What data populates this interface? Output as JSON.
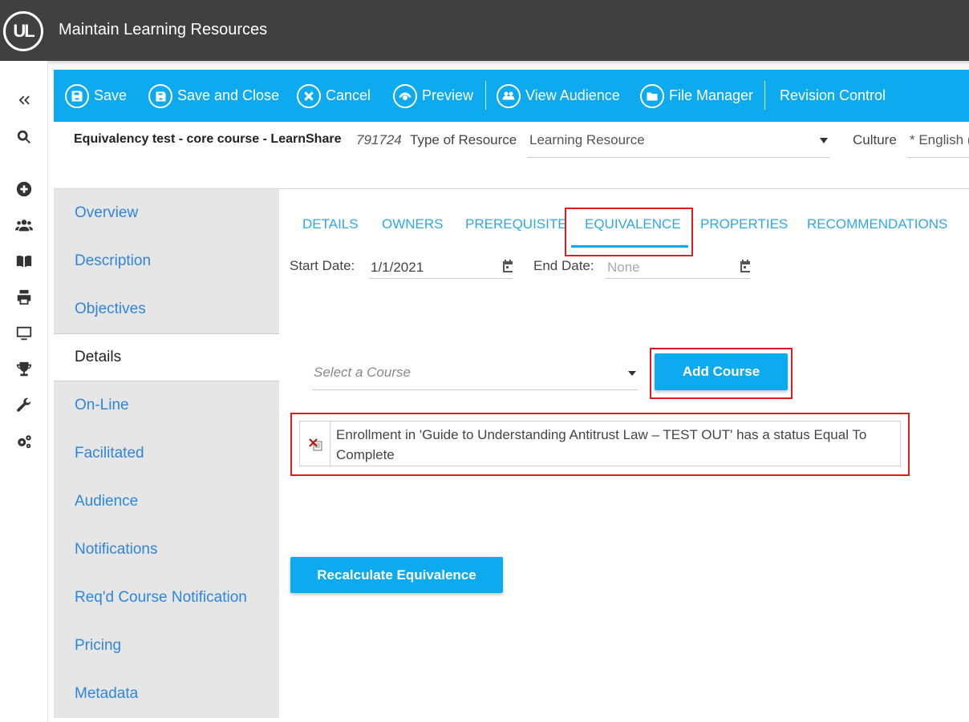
{
  "app": {
    "logo_text": "UL",
    "title": "Maintain Learning Resources"
  },
  "toolbar": {
    "save": "Save",
    "save_close": "Save and Close",
    "cancel": "Cancel",
    "preview": "Preview",
    "view_audience": "View Audience",
    "file_manager": "File Manager",
    "revision_control": "Revision Control"
  },
  "resource": {
    "name": "Equivalency test - core course - LearnShare",
    "id": "791724",
    "type_label": "Type of Resource",
    "type_value": "Learning Resource",
    "culture_label": "Culture",
    "culture_value": "* English ("
  },
  "sidenav": {
    "items": [
      {
        "label": "Overview"
      },
      {
        "label": "Description"
      },
      {
        "label": "Objectives"
      },
      {
        "label": "Details"
      },
      {
        "label": "On-Line"
      },
      {
        "label": "Facilitated"
      },
      {
        "label": "Audience"
      },
      {
        "label": "Notifications"
      },
      {
        "label": "Req'd Course Notification"
      },
      {
        "label": "Pricing"
      },
      {
        "label": "Metadata"
      }
    ],
    "active": "Details"
  },
  "tabs": [
    "DETAILS",
    "OWNERS",
    "PREREQUISITE",
    "EQUIVALENCE",
    "PROPERTIES",
    "RECOMMENDATIONS"
  ],
  "active_tab": "EQUIVALENCE",
  "dates": {
    "start_label": "Start Date:",
    "start_value": "1/1/2021",
    "end_label": "End Date:",
    "end_placeholder": "None"
  },
  "course_select": {
    "placeholder": "Select a Course"
  },
  "add_course": "Add Course",
  "rule_text": "Enrollment in 'Guide to Understanding Antitrust Law – TEST OUT' has a status Equal To Complete",
  "recalculate": "Recalculate Equivalence",
  "colors": {
    "toolbar": "#0eaaf0",
    "topbar": "#404040",
    "link": "#2e86de",
    "highlight": "#dd1d1d"
  }
}
